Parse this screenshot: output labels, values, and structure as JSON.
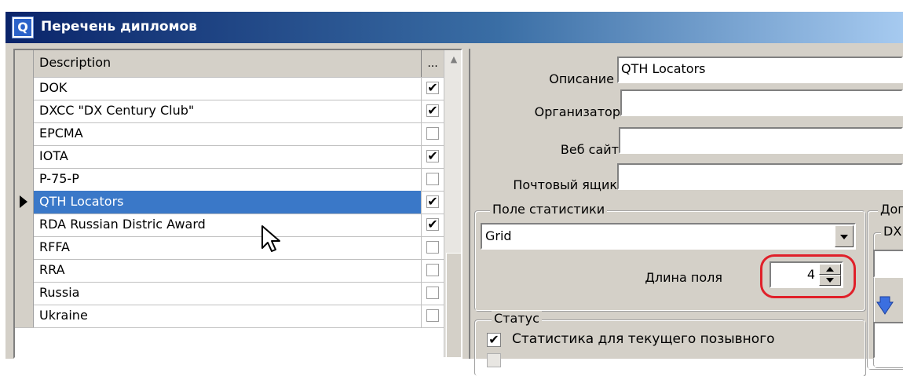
{
  "window": {
    "title": "Перечень дипломов",
    "icon": "app-logo-icon"
  },
  "grid": {
    "header": {
      "description": "Description",
      "check": "..."
    },
    "rows": [
      {
        "description": "DOK",
        "checked": true
      },
      {
        "description": "DXCC \"DX Century Club\"",
        "checked": true
      },
      {
        "description": "EPCMA",
        "checked": false
      },
      {
        "description": "IOTA",
        "checked": true
      },
      {
        "description": "P-75-P",
        "checked": false
      },
      {
        "description": "QTH Locators",
        "checked": true,
        "selected": true
      },
      {
        "description": "RDA Russian Distric Award",
        "checked": true
      },
      {
        "description": "RFFA",
        "checked": false
      },
      {
        "description": "RRA",
        "checked": false
      },
      {
        "description": "Russia",
        "checked": false
      },
      {
        "description": "Ukraine",
        "checked": false
      }
    ],
    "check_mark": "✔"
  },
  "form": {
    "description_label": "Описание",
    "description_value": "QTH Locators",
    "organizer_label": "Организатор",
    "organizer_value": "",
    "website_label": "Веб сайт",
    "website_value": "",
    "mailbox_label": "Почтовый ящик",
    "mailbox_value": ""
  },
  "stat_group": {
    "title": "Поле статистики",
    "field_value": "Grid",
    "length_label": "Длина поля",
    "length_value": "4"
  },
  "status_group": {
    "title": "Статус",
    "current_callsign_label": "Статистика для текущего позывного",
    "current_callsign_checked": true
  },
  "right_group": {
    "title": "Доп",
    "sub_title": "DX"
  },
  "colors": {
    "selection": "#3a78c8",
    "highlight": "#e0202a",
    "window_bg": "#d4d0c8"
  }
}
